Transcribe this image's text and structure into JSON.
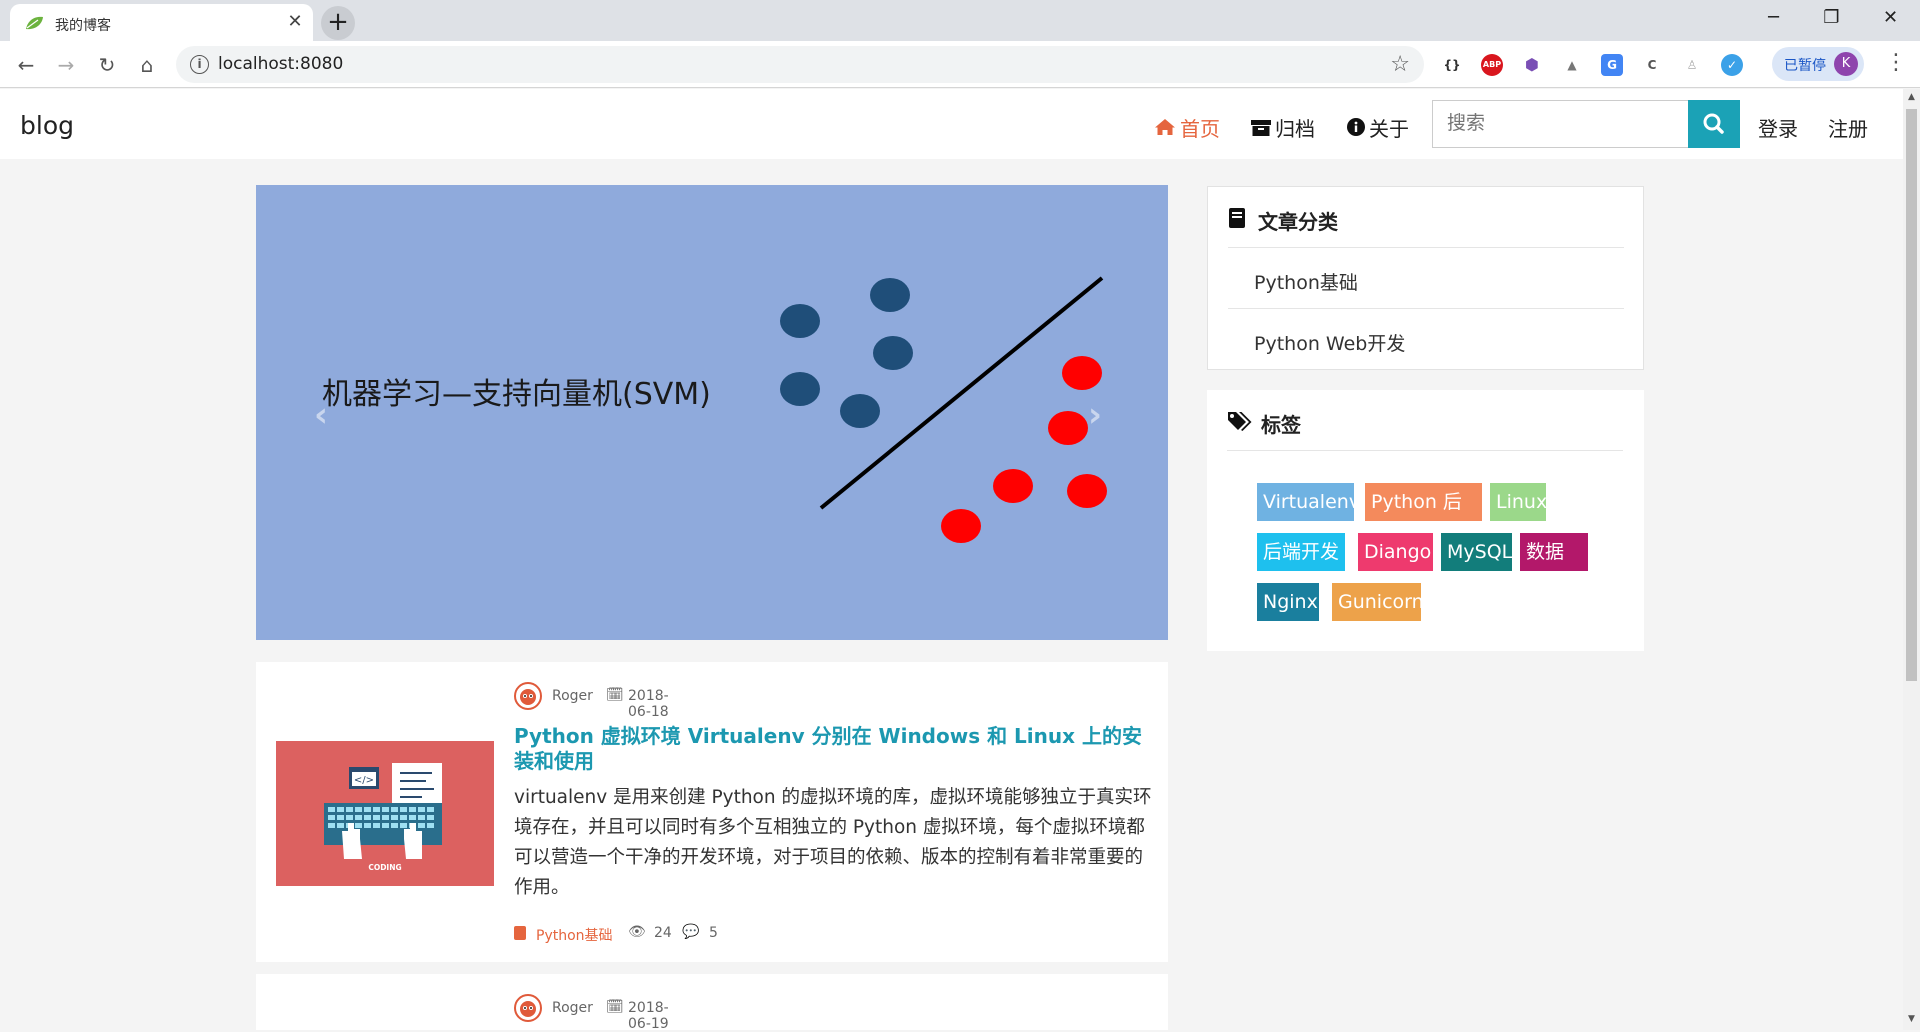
{
  "browser": {
    "tab_title": "我的博客",
    "tab_close": "✕",
    "new_tab": "+",
    "url": "localhost:8080",
    "profile_status": "已暂停",
    "profile_initial": "K"
  },
  "site": {
    "brand": "blog",
    "nav": [
      {
        "label": "首页",
        "icon": "home-icon",
        "active": true
      },
      {
        "label": "归档",
        "icon": "archive-icon",
        "active": false
      },
      {
        "label": "关于",
        "icon": "info-icon",
        "active": false
      }
    ],
    "search_placeholder": "搜索",
    "login": "登录",
    "register": "注册"
  },
  "carousel": {
    "caption": "机器学习—支持向量机(SVM)",
    "prev": "‹",
    "next": "›",
    "colors": {
      "background": "#8faadc",
      "class_a": "#1f4e79",
      "class_b": "#ff0000",
      "line": "#000000"
    }
  },
  "articles": [
    {
      "author": "Roger",
      "date": "2018-06-18",
      "title": "Python 虚拟环境 Virtualenv 分别在 Windows 和 Linux 上的安装和使用",
      "excerpt": "virtualenv 是用来创建 Python 的虚拟环境的库，虚拟环境能够独立于真实环境存在，并且可以同时有多个互相独立的 Python 虚拟环境，每个虚拟环境都可以营造一个干净的开发环境，对于项目的依赖、版本的控制有着非常重要的作用。",
      "thumb_label": "CODING",
      "thumb_code": "</>",
      "category": "Python基础",
      "views": "24",
      "comments": "5"
    },
    {
      "author": "Roger",
      "date": "2018-06-19"
    }
  ],
  "sidebar": {
    "categories_title": "文章分类",
    "categories": [
      "Python基础",
      "Python Web开发"
    ],
    "tags_title": "标签",
    "tags": [
      {
        "label": "Virtualenv",
        "color": "#6fb2e2"
      },
      {
        "label": "Python 后端",
        "color": "#f48a5c"
      },
      {
        "label": "Linux",
        "color": "#9bd88a"
      },
      {
        "label": "后端开发",
        "color": "#1ec0ee"
      },
      {
        "label": "Diango",
        "color": "#ee3a6e"
      },
      {
        "label": "MySQL",
        "color": "#127d7b"
      },
      {
        "label": "数据库",
        "color": "#b3186a"
      },
      {
        "label": "Nginx",
        "color": "#1a7f9e"
      },
      {
        "label": "Gunicorn",
        "color": "#eda24a"
      }
    ]
  }
}
